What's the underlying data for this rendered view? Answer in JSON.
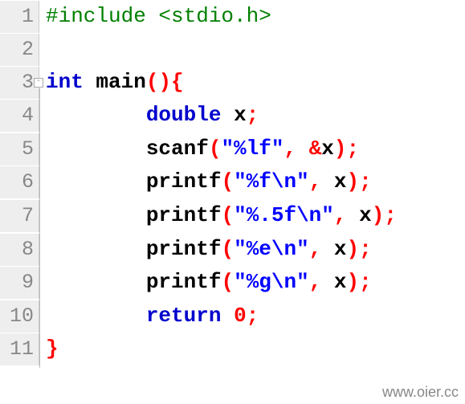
{
  "lines": {
    "n1": "1",
    "n2": "2",
    "n3": "3",
    "n4": "4",
    "n5": "5",
    "n6": "6",
    "n7": "7",
    "n8": "8",
    "n9": "9",
    "n10": "10",
    "n11": "11"
  },
  "code": {
    "include": "#include <stdio.h>",
    "int": "int",
    "main": " main",
    "lpar": "(",
    "rpar": ")",
    "lbrace": "{",
    "rbrace": "}",
    "double": "double",
    "space": " ",
    "x": "x",
    "xcomma": " x",
    "semicolon": ";",
    "scanf": "scanf",
    "printf": "printf",
    "comma": ",",
    "amp": "&",
    "fmt_lf": "\"%lf\"",
    "fmt_f": "\"%f\\n\"",
    "fmt_5f": "\"%.5f\\n\"",
    "fmt_e": "\"%e\\n\"",
    "fmt_g": "\"%g\\n\"",
    "return": "return",
    "zero": "0",
    "indent2": "    ",
    "indent4": "        "
  },
  "watermark": "www.oier.cc"
}
